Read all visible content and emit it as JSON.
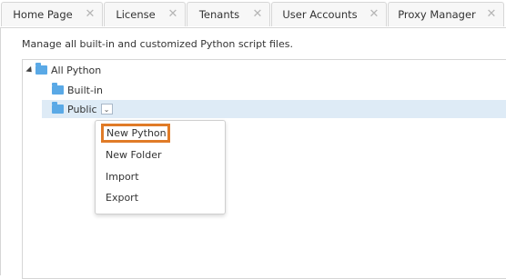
{
  "tabs": [
    {
      "label": "Home Page",
      "close_glyph": "✕"
    },
    {
      "label": "License",
      "close_glyph": "✕"
    },
    {
      "label": "Tenants",
      "close_glyph": "✕"
    },
    {
      "label": "User Accounts",
      "close_glyph": "✕"
    },
    {
      "label": "Proxy Manager",
      "close_glyph": "✕"
    }
  ],
  "description": "Manage all built-in and customized Python script files.",
  "tree": {
    "root": {
      "label": "All Python",
      "expanded": true
    },
    "children": [
      {
        "label": "Built-in"
      },
      {
        "label": "Public",
        "selected": true,
        "dropdown_glyph": "⌄"
      }
    ]
  },
  "context_menu": {
    "items": [
      {
        "label": "New Python",
        "highlighted": true
      },
      {
        "label": "New Folder"
      },
      {
        "label": "Import"
      },
      {
        "label": "Export"
      }
    ]
  },
  "colors": {
    "folder": "#5aa9e6",
    "selection": "#deebf6",
    "highlight_border": "#e07b27"
  },
  "icons": {
    "folder": "folder-icon",
    "expander": "expand-triangle-icon",
    "close": "close-icon",
    "dropdown": "chevron-down-icon"
  }
}
